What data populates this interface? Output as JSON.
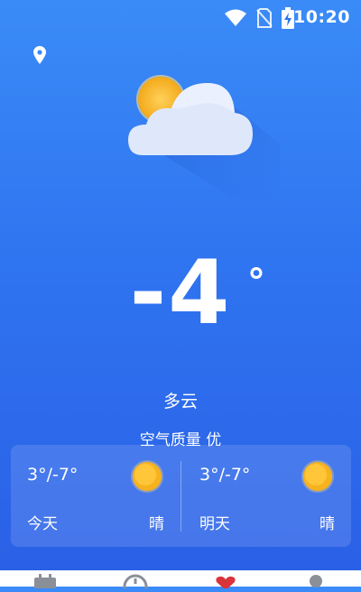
{
  "status_bar": {
    "time": "10:20",
    "icons": [
      "wifi-icon",
      "no-sim-icon",
      "battery-charging-icon"
    ]
  },
  "header": {
    "location_icon": "location-pin-icon"
  },
  "current": {
    "illustration_icon": "sun-behind-cloud-icon",
    "temperature": "-4",
    "degree_symbol": "°",
    "condition": "多云",
    "air_quality": "空气质量 优"
  },
  "forecast": [
    {
      "range": "3°/-7°",
      "day": "今天",
      "condition": "晴",
      "icon": "sun-icon"
    },
    {
      "range": "3°/-7°",
      "day": "明天",
      "condition": "晴",
      "icon": "sun-icon"
    }
  ],
  "bottom_nav": {
    "items": [
      {
        "icon": "calendar-icon"
      },
      {
        "icon": "compass-icon"
      },
      {
        "icon": "heart-icon"
      },
      {
        "icon": "user-icon"
      }
    ]
  },
  "colors": {
    "background_top": "#3a8bf7",
    "background_bottom": "#2a5fe6",
    "sun": "#f7b21f",
    "heart": "#d8343a"
  }
}
